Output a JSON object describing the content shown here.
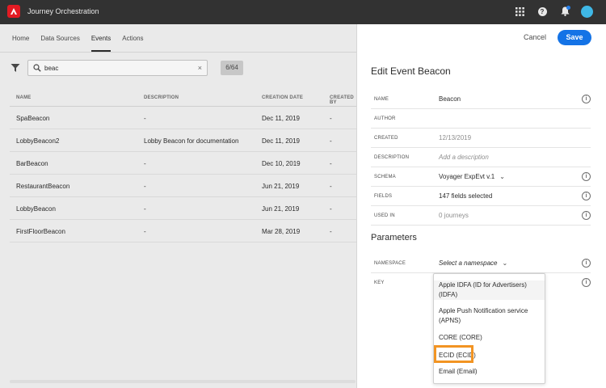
{
  "app": {
    "title": "Journey Orchestration"
  },
  "colors": {
    "topbar": "#323232",
    "accent": "#1473e6",
    "highlight": "#f29423",
    "logo": "#e31b23"
  },
  "icons": [
    "adobe-logo-icon",
    "apps-grid-icon",
    "help-icon",
    "bell-icon",
    "avatar",
    "filter-icon",
    "search-icon",
    "clear-icon",
    "info-icon",
    "chevron-down-icon"
  ],
  "nav": {
    "tabs": [
      "Home",
      "Data Sources",
      "Events",
      "Actions"
    ],
    "active": "Events"
  },
  "search": {
    "value": "beac",
    "clear": "×",
    "count": "6/64"
  },
  "table": {
    "headers": [
      "NAME",
      "DESCRIPTION",
      "CREATION DATE",
      "CREATED BY"
    ],
    "rows": [
      [
        "SpaBeacon",
        "-",
        "Dec 11, 2019",
        "-"
      ],
      [
        "LobbyBeacon2",
        "Lobby Beacon for documentation",
        "Dec 11, 2019",
        "-"
      ],
      [
        "BarBeacon",
        "-",
        "Dec 10, 2019",
        "-"
      ],
      [
        "RestaurantBeacon",
        "-",
        "Jun 21, 2019",
        "-"
      ],
      [
        "LobbyBeacon",
        "-",
        "Jun 21, 2019",
        "-"
      ],
      [
        "FirstFloorBeacon",
        "-",
        "Mar 28, 2019",
        "-"
      ]
    ]
  },
  "panel": {
    "cancel_label": "Cancel",
    "save_label": "Save",
    "title": "Edit Event Beacon",
    "fields": {
      "name": {
        "label": "NAME",
        "value": "Beacon"
      },
      "author": {
        "label": "AUTHOR",
        "value": ""
      },
      "created": {
        "label": "CREATED",
        "value": "12/13/2019"
      },
      "description": {
        "label": "DESCRIPTION",
        "value": "Add a description"
      },
      "schema": {
        "label": "SCHEMA",
        "value": "Voyager ExpEvt v.1"
      },
      "fields": {
        "label": "FIELDS",
        "value": "147 fields selected"
      },
      "used_in": {
        "label": "USED IN",
        "value": "0 journeys"
      }
    },
    "parameters_title": "Parameters",
    "namespace": {
      "label": "NAMESPACE",
      "value": "Select a namespace"
    },
    "key": {
      "label": "KEY"
    }
  },
  "namespace_options": [
    "Apple IDFA (ID for Advertisers) (IDFA)",
    "Apple Push Notification service (APNS)",
    "CORE (CORE)",
    "ECID (ECID)",
    "Email (Email)"
  ]
}
